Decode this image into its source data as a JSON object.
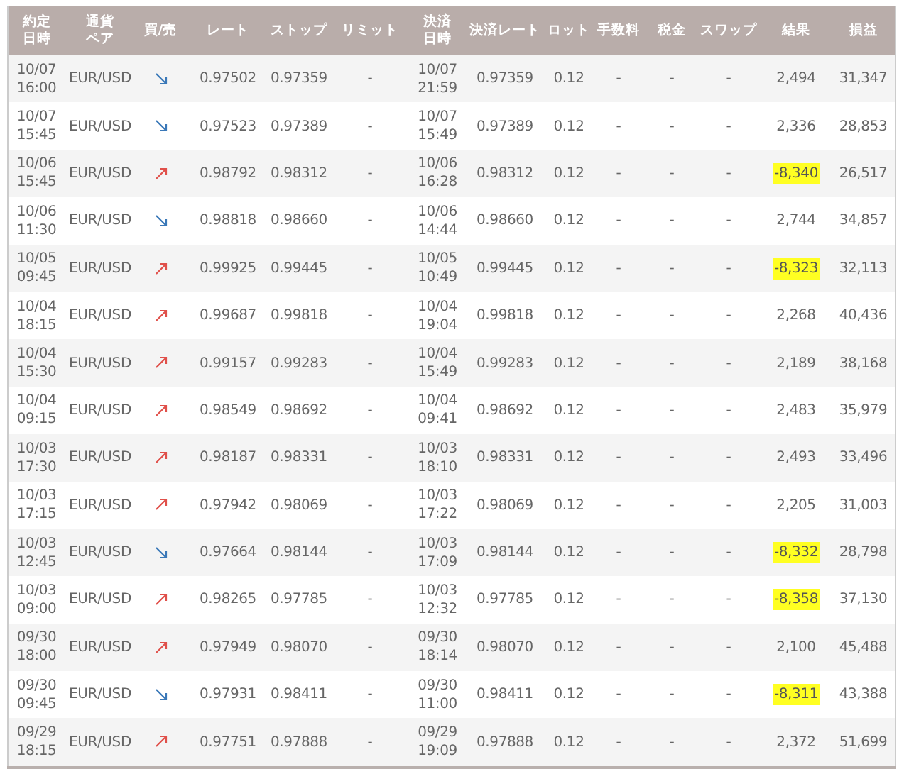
{
  "table": {
    "columns": [
      "約定日時",
      "通貨ペア",
      "買/売",
      "レート",
      "ストップ",
      "リミット",
      "決済日時",
      "決済レート",
      "ロット",
      "手数料",
      "税金",
      "スワップ",
      "結果",
      "損益"
    ],
    "rows": [
      {
        "opened": "10/07\n16:00",
        "pair": "EUR/USD",
        "kind": "sell",
        "rate": "0.97502",
        "stop": "0.97359",
        "limit": "-",
        "closed": "10/07\n21:59",
        "close_rate": "0.97359",
        "lot": "0.12",
        "fee": "-",
        "tax": "-",
        "swap": "-",
        "result": "2,494",
        "result_highlighted": false,
        "profit": "31,347"
      },
      {
        "opened": "10/07\n15:45",
        "pair": "EUR/USD",
        "kind": "sell",
        "rate": "0.97523",
        "stop": "0.97389",
        "limit": "-",
        "closed": "10/07\n15:49",
        "close_rate": "0.97389",
        "lot": "0.12",
        "fee": "-",
        "tax": "-",
        "swap": "-",
        "result": "2,336",
        "result_highlighted": false,
        "profit": "28,853"
      },
      {
        "opened": "10/06\n15:45",
        "pair": "EUR/USD",
        "kind": "buy",
        "rate": "0.98792",
        "stop": "0.98312",
        "limit": "-",
        "closed": "10/06\n16:28",
        "close_rate": "0.98312",
        "lot": "0.12",
        "fee": "-",
        "tax": "-",
        "swap": "-",
        "result": "-8,340",
        "result_highlighted": true,
        "profit": "26,517"
      },
      {
        "opened": "10/06\n11:30",
        "pair": "EUR/USD",
        "kind": "sell",
        "rate": "0.98818",
        "stop": "0.98660",
        "limit": "-",
        "closed": "10/06\n14:44",
        "close_rate": "0.98660",
        "lot": "0.12",
        "fee": "-",
        "tax": "-",
        "swap": "-",
        "result": "2,744",
        "result_highlighted": false,
        "profit": "34,857"
      },
      {
        "opened": "10/05\n09:45",
        "pair": "EUR/USD",
        "kind": "buy",
        "rate": "0.99925",
        "stop": "0.99445",
        "limit": "-",
        "closed": "10/05\n10:49",
        "close_rate": "0.99445",
        "lot": "0.12",
        "fee": "-",
        "tax": "-",
        "swap": "-",
        "result": "-8,323",
        "result_highlighted": true,
        "profit": "32,113"
      },
      {
        "opened": "10/04\n18:15",
        "pair": "EUR/USD",
        "kind": "buy",
        "rate": "0.99687",
        "stop": "0.99818",
        "limit": "-",
        "closed": "10/04\n19:04",
        "close_rate": "0.99818",
        "lot": "0.12",
        "fee": "-",
        "tax": "-",
        "swap": "-",
        "result": "2,268",
        "result_highlighted": false,
        "profit": "40,436"
      },
      {
        "opened": "10/04\n15:30",
        "pair": "EUR/USD",
        "kind": "buy",
        "rate": "0.99157",
        "stop": "0.99283",
        "limit": "-",
        "closed": "10/04\n15:49",
        "close_rate": "0.99283",
        "lot": "0.12",
        "fee": "-",
        "tax": "-",
        "swap": "-",
        "result": "2,189",
        "result_highlighted": false,
        "profit": "38,168"
      },
      {
        "opened": "10/04\n09:15",
        "pair": "EUR/USD",
        "kind": "buy",
        "rate": "0.98549",
        "stop": "0.98692",
        "limit": "-",
        "closed": "10/04\n09:41",
        "close_rate": "0.98692",
        "lot": "0.12",
        "fee": "-",
        "tax": "-",
        "swap": "-",
        "result": "2,483",
        "result_highlighted": false,
        "profit": "35,979"
      },
      {
        "opened": "10/03\n17:30",
        "pair": "EUR/USD",
        "kind": "buy",
        "rate": "0.98187",
        "stop": "0.98331",
        "limit": "-",
        "closed": "10/03\n18:10",
        "close_rate": "0.98331",
        "lot": "0.12",
        "fee": "-",
        "tax": "-",
        "swap": "-",
        "result": "2,493",
        "result_highlighted": false,
        "profit": "33,496"
      },
      {
        "opened": "10/03\n17:15",
        "pair": "EUR/USD",
        "kind": "buy",
        "rate": "0.97942",
        "stop": "0.98069",
        "limit": "-",
        "closed": "10/03\n17:22",
        "close_rate": "0.98069",
        "lot": "0.12",
        "fee": "-",
        "tax": "-",
        "swap": "-",
        "result": "2,205",
        "result_highlighted": false,
        "profit": "31,003"
      },
      {
        "opened": "10/03\n12:45",
        "pair": "EUR/USD",
        "kind": "sell",
        "rate": "0.97664",
        "stop": "0.98144",
        "limit": "-",
        "closed": "10/03\n17:09",
        "close_rate": "0.98144",
        "lot": "0.12",
        "fee": "-",
        "tax": "-",
        "swap": "-",
        "result": "-8,332",
        "result_highlighted": true,
        "profit": "28,798"
      },
      {
        "opened": "10/03\n09:00",
        "pair": "EUR/USD",
        "kind": "buy",
        "rate": "0.98265",
        "stop": "0.97785",
        "limit": "-",
        "closed": "10/03\n12:32",
        "close_rate": "0.97785",
        "lot": "0.12",
        "fee": "-",
        "tax": "-",
        "swap": "-",
        "result": "-8,358",
        "result_highlighted": true,
        "profit": "37,130"
      },
      {
        "opened": "09/30\n18:00",
        "pair": "EUR/USD",
        "kind": "buy",
        "rate": "0.97949",
        "stop": "0.98070",
        "limit": "-",
        "closed": "09/30\n18:14",
        "close_rate": "0.98070",
        "lot": "0.12",
        "fee": "-",
        "tax": "-",
        "swap": "-",
        "result": "2,100",
        "result_highlighted": false,
        "profit": "45,488"
      },
      {
        "opened": "09/30\n09:45",
        "pair": "EUR/USD",
        "kind": "sell",
        "rate": "0.97931",
        "stop": "0.98411",
        "limit": "-",
        "closed": "09/30\n11:00",
        "close_rate": "0.98411",
        "lot": "0.12",
        "fee": "-",
        "tax": "-",
        "swap": "-",
        "result": "-8,311",
        "result_highlighted": true,
        "profit": "43,388"
      },
      {
        "opened": "09/29\n18:15",
        "pair": "EUR/USD",
        "kind": "buy",
        "rate": "0.97751",
        "stop": "0.97888",
        "limit": "-",
        "closed": "09/29\n19:09",
        "close_rate": "0.97888",
        "lot": "0.12",
        "fee": "-",
        "tax": "-",
        "swap": "-",
        "result": "2,372",
        "result_highlighted": false,
        "profit": "51,699"
      }
    ]
  }
}
